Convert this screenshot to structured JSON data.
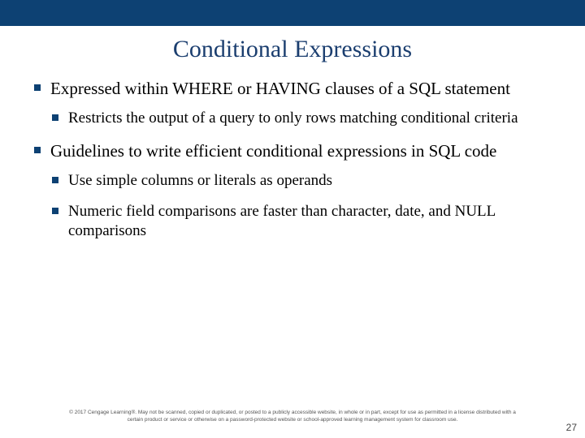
{
  "title": "Conditional Expressions",
  "bullets": {
    "b1": "Expressed within WHERE or HAVING clauses of a SQL statement",
    "b1_1": "Restricts the output of a query to only rows matching conditional criteria",
    "b2": "Guidelines to write efficient conditional expressions in SQL code",
    "b2_1": "Use simple columns or literals as operands",
    "b2_2": "Numeric field comparisons are faster than character, date, and NULL comparisons"
  },
  "footer": {
    "line1": "© 2017 Cengage Learning®. May not be scanned, copied or duplicated, or posted to a publicly accessible website, in whole or in part, except for use as permitted in a license distributed with a",
    "line2": "certain product or service or otherwise on a password-protected website or school-approved learning management system for classroom use."
  },
  "page_number": "27"
}
